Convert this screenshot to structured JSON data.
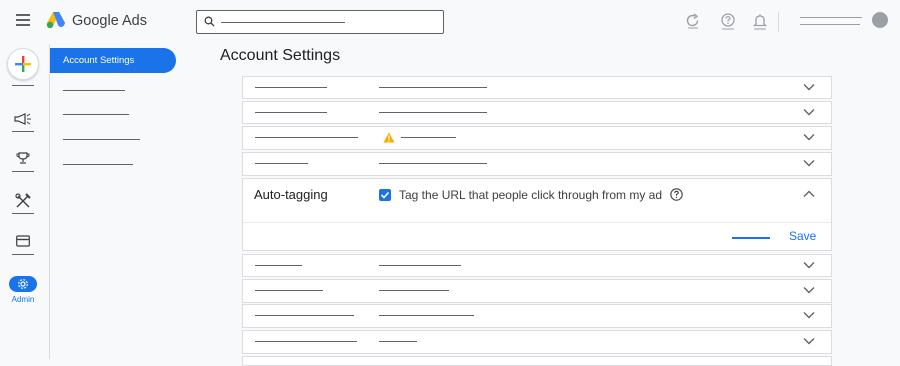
{
  "app": {
    "brand": "Google Ads"
  },
  "topbar": {
    "search_icon": "search-icon",
    "icons": [
      "refresh-icon",
      "help-icon",
      "notifications-icon"
    ],
    "avatar": "avatar"
  },
  "rail": {
    "create_icon": "plus-icon",
    "items": [
      "campaigns-icon",
      "goals-icon",
      "tools-icon",
      "billing-icon"
    ],
    "admin": {
      "icon": "gear-icon",
      "label": "Admin"
    }
  },
  "nav": {
    "active_label": "Account Settings"
  },
  "page": {
    "title": "Account Settings"
  },
  "expanded": {
    "title": "Auto-tagging",
    "checkbox_checked": true,
    "checkbox_label": "Tag the URL that people click through from my ad",
    "save_label": "Save"
  },
  "colors": {
    "accent": "#1a73e8",
    "warning": "#f9ab00"
  }
}
